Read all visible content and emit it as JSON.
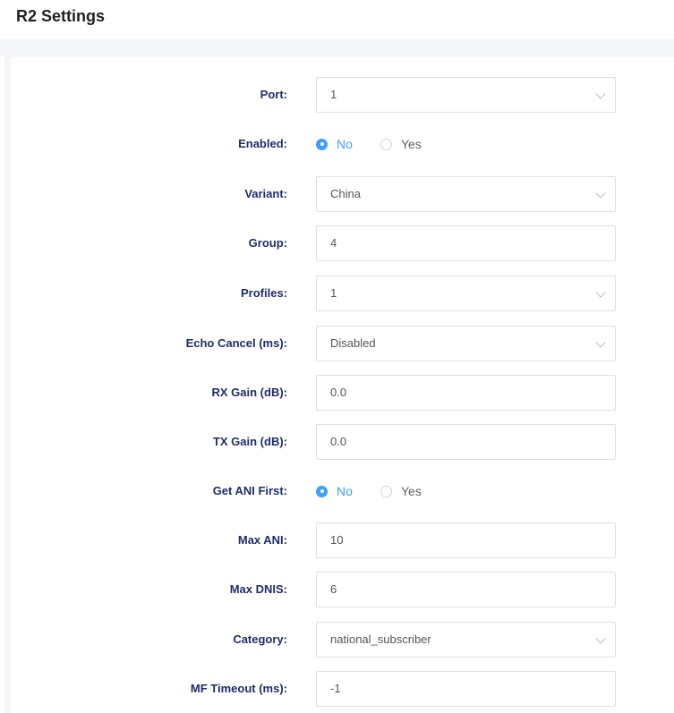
{
  "header": {
    "title": "R2 Settings"
  },
  "form": {
    "port": {
      "label": "Port:",
      "value": "1"
    },
    "enabled": {
      "label": "Enabled:",
      "options": [
        "No",
        "Yes"
      ],
      "selected": "No"
    },
    "variant": {
      "label": "Variant:",
      "value": "China"
    },
    "group": {
      "label": "Group:",
      "value": "4"
    },
    "profiles": {
      "label": "Profiles:",
      "value": "1"
    },
    "echo_cancel": {
      "label": "Echo Cancel (ms):",
      "value": "Disabled"
    },
    "rx_gain": {
      "label": "RX Gain (dB):",
      "value": "0.0"
    },
    "tx_gain": {
      "label": "TX Gain (dB):",
      "value": "0.0"
    },
    "get_ani_first": {
      "label": "Get ANI First:",
      "options": [
        "No",
        "Yes"
      ],
      "selected": "No"
    },
    "max_ani": {
      "label": "Max ANI:",
      "value": "10"
    },
    "max_dnis": {
      "label": "Max DNIS:",
      "value": "6"
    },
    "category": {
      "label": "Category:",
      "value": "national_subscriber"
    },
    "mf_timeout": {
      "label": "MF Timeout (ms):",
      "value": "-1"
    }
  },
  "colors": {
    "accent": "#409eff",
    "label": "#1f2d6b",
    "border": "#dcdfe6"
  },
  "icons": {
    "select": "chevron-down-icon"
  }
}
